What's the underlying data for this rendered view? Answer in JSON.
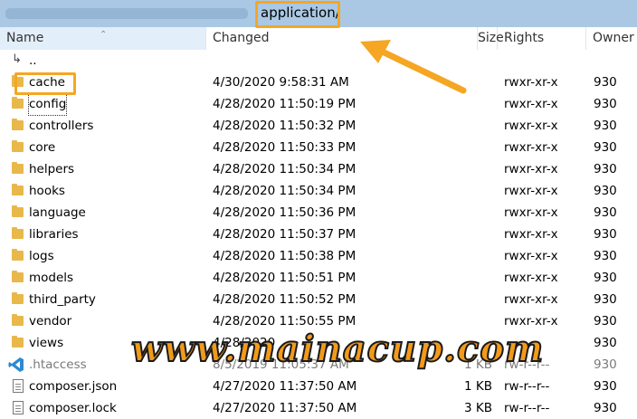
{
  "path": {
    "current": "application/"
  },
  "columns": {
    "name": "Name",
    "changed": "Changed",
    "size": "Size",
    "rights": "Rights",
    "owner": "Owner"
  },
  "rows": [
    {
      "name": "..",
      "changed": "",
      "size": "",
      "rights": "",
      "owner": "",
      "type": "up"
    },
    {
      "name": "cache",
      "changed": "4/30/2020 9:58:31 AM",
      "size": "",
      "rights": "rwxr-xr-x",
      "owner": "930",
      "type": "folder"
    },
    {
      "name": "config",
      "changed": "4/28/2020 11:50:19 PM",
      "size": "",
      "rights": "rwxr-xr-x",
      "owner": "930",
      "type": "folder"
    },
    {
      "name": "controllers",
      "changed": "4/28/2020 11:50:32 PM",
      "size": "",
      "rights": "rwxr-xr-x",
      "owner": "930",
      "type": "folder"
    },
    {
      "name": "core",
      "changed": "4/28/2020 11:50:33 PM",
      "size": "",
      "rights": "rwxr-xr-x",
      "owner": "930",
      "type": "folder"
    },
    {
      "name": "helpers",
      "changed": "4/28/2020 11:50:34 PM",
      "size": "",
      "rights": "rwxr-xr-x",
      "owner": "930",
      "type": "folder"
    },
    {
      "name": "hooks",
      "changed": "4/28/2020 11:50:34 PM",
      "size": "",
      "rights": "rwxr-xr-x",
      "owner": "930",
      "type": "folder"
    },
    {
      "name": "language",
      "changed": "4/28/2020 11:50:36 PM",
      "size": "",
      "rights": "rwxr-xr-x",
      "owner": "930",
      "type": "folder"
    },
    {
      "name": "libraries",
      "changed": "4/28/2020 11:50:37 PM",
      "size": "",
      "rights": "rwxr-xr-x",
      "owner": "930",
      "type": "folder"
    },
    {
      "name": "logs",
      "changed": "4/28/2020 11:50:38 PM",
      "size": "",
      "rights": "rwxr-xr-x",
      "owner": "930",
      "type": "folder"
    },
    {
      "name": "models",
      "changed": "4/28/2020 11:50:51 PM",
      "size": "",
      "rights": "rwxr-xr-x",
      "owner": "930",
      "type": "folder"
    },
    {
      "name": "third_party",
      "changed": "4/28/2020 11:50:52 PM",
      "size": "",
      "rights": "rwxr-xr-x",
      "owner": "930",
      "type": "folder"
    },
    {
      "name": "vendor",
      "changed": "4/28/2020 11:50:55 PM",
      "size": "",
      "rights": "rwxr-xr-x",
      "owner": "930",
      "type": "folder"
    },
    {
      "name": "views",
      "changed": "4/28/2020",
      "size": "",
      "rights": "",
      "owner": "930",
      "type": "folder"
    },
    {
      "name": ".htaccess",
      "changed": "8/5/2019 11:05:37 AM",
      "size": "1 KB",
      "rights": "rw-r--r--",
      "owner": "930",
      "type": "vscode"
    },
    {
      "name": "composer.json",
      "changed": "4/27/2020 11:37:50 AM",
      "size": "1 KB",
      "rights": "rw-r--r--",
      "owner": "930",
      "type": "file"
    },
    {
      "name": "composer.lock",
      "changed": "4/27/2020 11:37:50 AM",
      "size": "3 KB",
      "rights": "rw-r--r--",
      "owner": "930",
      "type": "file"
    }
  ],
  "watermark": {
    "text": "www.mainacup.com"
  },
  "colors": {
    "highlight": "#f5a623",
    "folder": "#e8b84a",
    "pathbar": "#aac8e4",
    "header_sorted": "#e3eefb"
  }
}
